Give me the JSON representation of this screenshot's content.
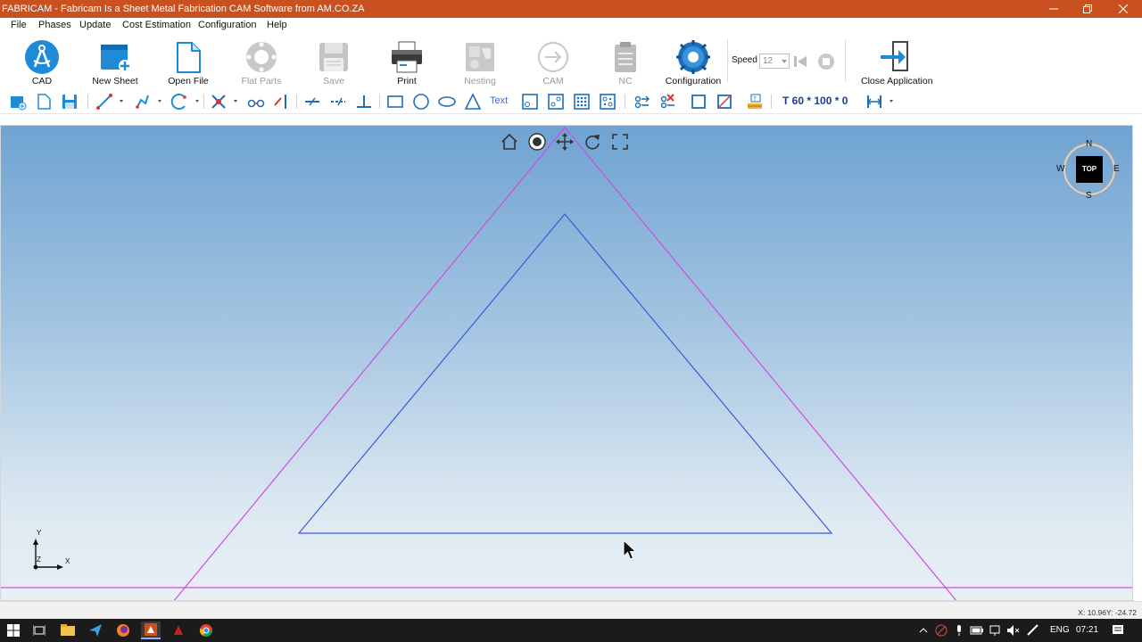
{
  "window": {
    "title": "FABRICAM - Fabricam Is a Sheet Metal Fabrication CAM Software from AM.CO.ZA",
    "title_color": "#c8511f"
  },
  "menu": [
    "File",
    "Phases",
    "Update",
    "Cost Estimation",
    "Configuration",
    "Help"
  ],
  "ribbon": {
    "cad": "CAD",
    "new_sheet": "New Sheet",
    "open_file": "Open File",
    "flat_parts": "Flat Parts",
    "save": "Save",
    "print": "Print",
    "nesting": "Nesting",
    "cam": "CAM",
    "nc": "NC",
    "configuration": "Configuration",
    "speed_label": "Speed",
    "speed_value": "12",
    "close_application": "Close Application"
  },
  "toolbar": {
    "text_tool": "Text",
    "dimension": "T 60 * 100 * 0"
  },
  "compass": {
    "n": "N",
    "s": "S",
    "e": "E",
    "w": "W",
    "face": "TOP"
  },
  "axis": {
    "y": "Y",
    "x": "X",
    "z": "Z"
  },
  "status": {
    "coords": "X: 10.96Y: -24.72"
  },
  "taskbar": {
    "lang": "ENG",
    "time": "07:21"
  },
  "colors": {
    "outer_triangle": "#d24be0",
    "inner_triangle": "#3c5ad8",
    "sheet_line": "#d24be0",
    "accent": "#1f8ad8"
  }
}
